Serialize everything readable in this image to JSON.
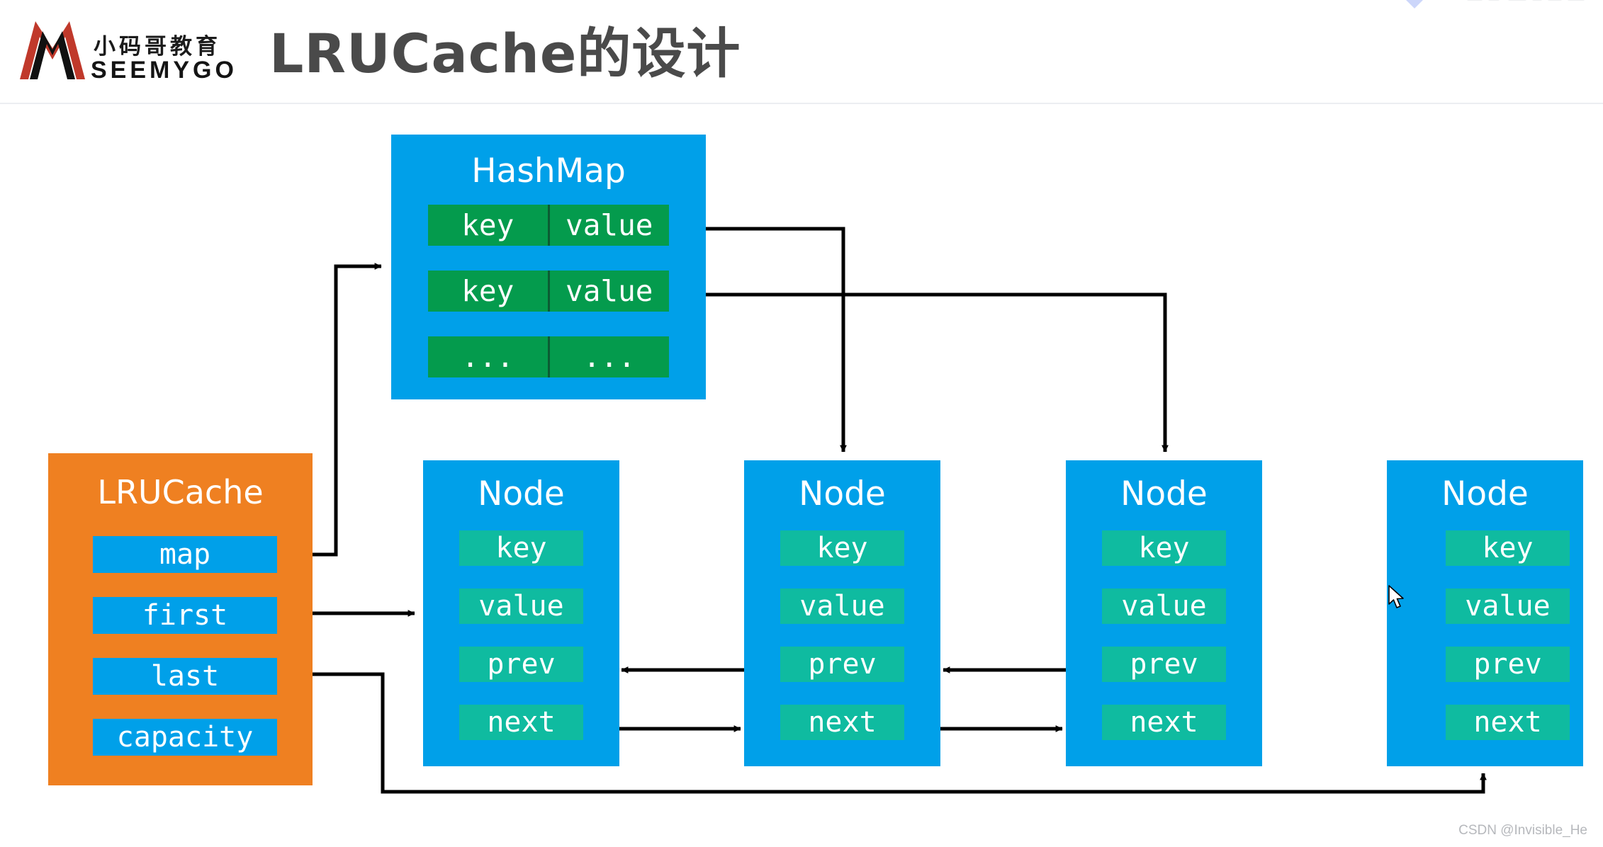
{
  "header": {
    "title": "LRUCache的设计",
    "logo": {
      "cn": "小码哥教育",
      "en": "SEEMYGO",
      "mark": "seemygo-m-logo"
    }
  },
  "colors": {
    "blue": "#00a0e9",
    "orange": "#ef8021",
    "green": "#049b4d",
    "teal": "#0fbba0",
    "title_gray": "#4a4a4a",
    "logo_red": "#c0392b",
    "logo_black": "#111111",
    "connector": "#000000",
    "watermark": "#b6b8bc"
  },
  "diagram": {
    "hashmap": {
      "title": "HashMap",
      "columns": [
        "key",
        "value"
      ],
      "rows": [
        {
          "key": "key",
          "value": "value"
        },
        {
          "key": "key",
          "value": "value"
        },
        {
          "key": "...",
          "value": "..."
        }
      ]
    },
    "lrucache": {
      "title": "LRUCache",
      "fields": [
        "map",
        "first",
        "last",
        "capacity"
      ]
    },
    "node_title": "Node",
    "node_fields": [
      "key",
      "value",
      "prev",
      "next"
    ],
    "nodes": [
      {
        "title": "Node",
        "fields": [
          "key",
          "value",
          "prev",
          "next"
        ]
      },
      {
        "title": "Node",
        "fields": [
          "key",
          "value",
          "prev",
          "next"
        ]
      },
      {
        "title": "Node",
        "fields": [
          "key",
          "value",
          "prev",
          "next"
        ]
      },
      {
        "title": "Node",
        "fields": [
          "key",
          "value",
          "prev",
          "next"
        ]
      }
    ],
    "connectors": [
      "lrucache.map -> hashmap",
      "lrucache.first -> node1",
      "lrucache.last -> node4",
      "hashmap.row1.value -> node2",
      "hashmap.row2.value -> node3",
      "node1.next -> node2",
      "node2.next -> node3",
      "node2.prev -> node1",
      "node3.prev -> node2"
    ]
  },
  "watermark": "CSDN @Invisible_He"
}
